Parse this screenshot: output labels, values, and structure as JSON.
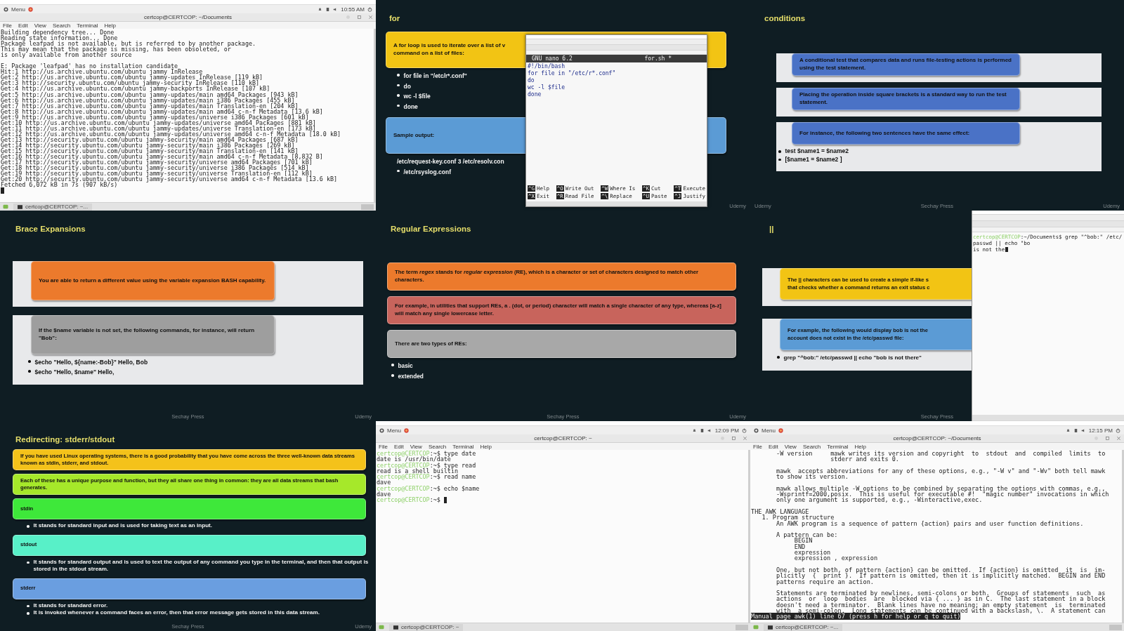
{
  "frames": [
    {
      "kind": "terminal",
      "menu": "Menu",
      "time": "10:55 AM",
      "title": "certcop@CERTCOP: ~/Documents",
      "menus": [
        "File",
        "Edit",
        "View",
        "Search",
        "Terminal",
        "Help"
      ],
      "taskbar": "certcop@CERTCOP: ~...",
      "paragraphs": [
        {
          "lines": [
            {
              "kind": "output",
              "text": "Building dependency tree... Done"
            },
            {
              "kind": "output",
              "text": "Reading state information... Done"
            },
            {
              "kind": "output",
              "text": "Package leafpad is not available, but is referred to by another package."
            },
            {
              "kind": "output",
              "text": "This may mean that the package is missing, has been obsoleted, or"
            },
            {
              "kind": "output",
              "text": "is only available from another source"
            }
          ]
        },
        {
          "lines": [
            {
              "kind": "output",
              "text": "E: Package 'leafpad' has no installation candidate"
            },
            {
              "kind": "output",
              "text": "Hit:1 http://us.archive.ubuntu.com/ubuntu jammy InRelease"
            },
            {
              "kind": "output",
              "text": "Get:2 http://us.archive.ubuntu.com/ubuntu jammy-updates InRelease [119 kB]"
            },
            {
              "kind": "output",
              "text": "Get:3 http://security.ubuntu.com/ubuntu jammy-security InRelease [110 kB]"
            },
            {
              "kind": "output",
              "text": "Get:4 http://us.archive.ubuntu.com/ubuntu jammy-backports InRelease [107 kB]"
            },
            {
              "kind": "output",
              "text": "Get:5 http://us.archive.ubuntu.com/ubuntu jammy-updates/main amd64 Packages [943 kB]"
            },
            {
              "kind": "output",
              "text": "Get:6 http://us.archive.ubuntu.com/ubuntu jammy-updates/main i386 Packages [455 kB]"
            },
            {
              "kind": "output",
              "text": "Get:7 http://us.archive.ubuntu.com/ubuntu jammy-updates/main Translation-en [204 kB]"
            },
            {
              "kind": "output",
              "text": "Get:8 http://us.archive.ubuntu.com/ubuntu jammy-updates/main amd64 c-n-f Metadata [13.6 kB]"
            },
            {
              "kind": "output",
              "text": "Get:9 http://us.archive.ubuntu.com/ubuntu jammy-updates/universe i386 Packages [601 kB]"
            },
            {
              "kind": "output",
              "text": "Get:10 http://us.archive.ubuntu.com/ubuntu jammy-updates/universe amd64 Packages [881 kB]"
            },
            {
              "kind": "output",
              "text": "Get:11 http://us.archive.ubuntu.com/ubuntu jammy-updates/universe Translation-en [173 kB]"
            },
            {
              "kind": "output",
              "text": "Get:12 http://us.archive.ubuntu.com/ubuntu jammy-updates/universe amd64 c-n-f Metadata [18.0 kB]"
            },
            {
              "kind": "output",
              "text": "Get:13 http://security.ubuntu.com/ubuntu jammy-security/main amd64 Packages [687 kB]"
            },
            {
              "kind": "output",
              "text": "Get:14 http://security.ubuntu.com/ubuntu jammy-security/main i386 Packages [269 kB]"
            },
            {
              "kind": "output",
              "text": "Get:15 http://security.ubuntu.com/ubuntu jammy-security/main Translation-en [141 kB]"
            },
            {
              "kind": "output",
              "text": "Get:16 http://security.ubuntu.com/ubuntu jammy-security/main amd64 c-n-f Metadata [8,832 B]"
            },
            {
              "kind": "output",
              "text": "Get:17 http://security.ubuntu.com/ubuntu jammy-security/universe amd64 Packages [701 kB]"
            },
            {
              "kind": "output",
              "text": "Get:18 http://security.ubuntu.com/ubuntu jammy-security/universe i386 Packages [514 kB]"
            },
            {
              "kind": "output",
              "text": "Get:19 http://security.ubuntu.com/ubuntu jammy-security/universe Translation-en [112 kB]"
            },
            {
              "kind": "output",
              "text": "Get:20 http://security.ubuntu.com/ubuntu jammy-security/universe amd64 c-n-f Metadata [13.6 kB]"
            },
            {
              "kind": "output",
              "text": "Fetched 6,072 kB in 7s (907 kB/s)"
            },
            {
              "kind": "cursor"
            }
          ]
        }
      ]
    },
    {
      "kind": "slide",
      "title": "for",
      "blocks": [
        {
          "kind": "box",
          "color": "#f2c414",
          "lines": [
            "A for loop is used to iterate over a list of v",
            "command on a list of files:"
          ],
          "bullets": [
            {
              "text": "for file in \"/etc/r*.conf\"",
              "bullet": true
            },
            {
              "text": "do",
              "bullet": true
            },
            {
              "text": "wc -l $file",
              "bullet": true
            },
            {
              "text": "done",
              "bullet": true
            }
          ]
        },
        {
          "kind": "box",
          "color": "#5b9bd5",
          "text": "Sample output:",
          "bullets": [
            {
              "text": "/etc/request-key.conf 3 /etc/resolv.con",
              "bullet": false
            },
            {
              "text": "/etc/rsyslog.conf",
              "bullet": true
            }
          ]
        }
      ],
      "overlay": {
        "kind": "nano",
        "header_left": "GNU nano 6.2",
        "header_right": "for.sh *",
        "code": [
          "#!/bin/bash",
          "for file in \"/etc/r*.conf\"",
          "do",
          "wc -l $file",
          "done"
        ],
        "shortcuts": [
          {
            "key": "^G",
            "label": "Help"
          },
          {
            "key": "^O",
            "label": "Write Out"
          },
          {
            "key": "^W",
            "label": "Where Is"
          },
          {
            "key": "^K",
            "label": "Cut"
          },
          {
            "key": "^T",
            "label": "Execute"
          },
          {
            "key": "^X",
            "label": "Exit"
          },
          {
            "key": "^R",
            "label": "Read File"
          },
          {
            "key": "^\\",
            "label": "Replace"
          },
          {
            "key": "^U",
            "label": "Paste"
          },
          {
            "key": "^J",
            "label": "Justify"
          }
        ]
      },
      "footer": [
        {
          "text": "Udemy",
          "kind": "right"
        }
      ]
    },
    {
      "kind": "slide",
      "title": "conditions",
      "blocks": [
        {
          "kind": "band",
          "color": "#4a72c6",
          "text": "A conditional test that compares data and runs file-testing actions is performed using the test statement."
        },
        {
          "kind": "band",
          "color": "#4a72c6",
          "text": "Placing the operation inside square brackets is a standard way to run the test statement."
        },
        {
          "kind": "band",
          "color": "#4a72c6",
          "text": "For instance, the following two sentences have the same effect:",
          "bullets": [
            {
              "text": "test $name1 = $name2",
              "bullet": true
            },
            {
              "text": "[$name1 = $name2 ]",
              "bullet": true
            }
          ]
        }
      ],
      "footer": [
        {
          "text": "Udemy",
          "kind": "left"
        },
        {
          "text": "Sechay Press",
          "kind": "center"
        },
        {
          "text": "Udemy",
          "kind": "right"
        }
      ]
    },
    {
      "kind": "slide",
      "title": "Brace Expansions",
      "blocks": [
        {
          "kind": "band",
          "color": "#ec7a2c",
          "text": "You are able to return a different value using the variable expansion BASH capability."
        },
        {
          "kind": "band",
          "color": "#9e9e9e",
          "text": "If the $name variable is not set, the following commands, for instance, will return \"Bob\":",
          "bullets": [
            {
              "text": "$echo \"Hello, ${name:-Bob}\" Hello, Bob",
              "bullet": true
            },
            {
              "text": "$echo \"Hello, $name\" Hello,",
              "bullet": true
            }
          ]
        }
      ],
      "footer": [
        {
          "text": "Sechay Press",
          "kind": "center"
        },
        {
          "text": "Udemy",
          "kind": "right"
        }
      ]
    },
    {
      "kind": "slide",
      "title": "Regular Expressions",
      "blocks": [
        {
          "kind": "box",
          "color": "#ec7a2c",
          "text": "The term *regex* stands for *regular expression* (RE), which is a character or set of characters designed to match other characters."
        },
        {
          "kind": "box",
          "color": "#c8645c",
          "text": "For example, in utilities that support REs, a . (dot, or period) character will match a single character of any type, whereas [a-z] will match any single lowercase letter."
        },
        {
          "kind": "box",
          "color": "#a8a8a8",
          "text": "There are two types of REs:",
          "bullets": [
            {
              "text": "basic",
              "bullet": true
            },
            {
              "text": "extended",
              "bullet": true
            }
          ]
        }
      ],
      "footer": [
        {
          "text": "Sechay Press",
          "kind": "center"
        },
        {
          "text": "Udemy",
          "kind": "right"
        }
      ]
    },
    {
      "kind": "slide",
      "title": "||",
      "blocks": [
        {
          "kind": "band",
          "color": "#f2c414",
          "lines": [
            "The || characters can be used to create a simple if-like s",
            "that checks whether a command returns an exit status c"
          ]
        },
        {
          "kind": "band",
          "color": "#5b9bd5",
          "lines": [
            "For example, the following would display bob is not the",
            "account does not exist in the /etc/passwd file:"
          ],
          "bullets": [
            {
              "text": "grep \"^bob:\" /etc/passwd || echo \"bob is not there\"",
              "bullet": true
            }
          ]
        }
      ],
      "overlay": {
        "kind": "mini_terminal",
        "lines": [
          {
            "kind": "prompt",
            "host": "certcop@CERTCOP",
            "text": ":~/Documents$ grep \"^bob:\" /etc/passwd || echo \"bo"
          },
          {
            "kind": "output",
            "text": "is not the",
            "cursor": true
          }
        ]
      },
      "footer": [
        {
          "text": "Sechay Press",
          "kind": "center"
        }
      ]
    },
    {
      "kind": "slide",
      "title": "Redirecting: stderr/stdout",
      "blocks": [
        {
          "kind": "box",
          "color": "#f4c21a",
          "text": "If you have used Linux operating systems, there is a good probability that you have come across the three well-known data streams known as stdin, stderr, and stdout."
        },
        {
          "kind": "box",
          "color": "#a6e82a",
          "text": "Each of these has a unique purpose and function, but they all share one thing in common: they are all data streams that bash generates."
        },
        {
          "kind": "box",
          "color": "#3ee83a",
          "text": "stdin",
          "bullets": [
            {
              "text": "It stands for standard input and is used for taking text as an input.",
              "bullet": true
            }
          ]
        },
        {
          "kind": "box",
          "color": "#58f0c8",
          "text": "stdout",
          "bullets": [
            {
              "text": "It stands for standard output and is used to text the output of any command you type in the terminal, and then that output is stored in the stdout stream.",
              "bullet": true
            }
          ]
        },
        {
          "kind": "box",
          "color": "#6a9ee0",
          "text": "stderr",
          "bullets": [
            {
              "text": "It stands for standard error.",
              "bullet": true
            },
            {
              "text": "It is invoked whenever a command faces an error, then that error message gets stored in this data stream.",
              "bullet": true
            }
          ]
        }
      ],
      "footer": [
        {
          "text": "Sechay Press",
          "kind": "center"
        },
        {
          "text": "Udemy",
          "kind": "right"
        }
      ]
    },
    {
      "kind": "terminal",
      "menu": "Menu",
      "time": "12:09 PM",
      "title": "certcop@CERTCOP: ~",
      "menus": [
        "File",
        "Edit",
        "View",
        "Search",
        "Terminal",
        "Help"
      ],
      "taskbar": "certcop@CERTCOP: ~",
      "paragraphs": [
        {
          "lines": [
            {
              "kind": "prompt",
              "host": "certcop@CERTCOP",
              "text": ":~$ type date"
            },
            {
              "kind": "output",
              "text": "date is /usr/bin/date"
            },
            {
              "kind": "prompt",
              "host": "certcop@CERTCOP",
              "text": ":~$ type read"
            },
            {
              "kind": "output",
              "text": "read is a shell builtin"
            },
            {
              "kind": "prompt",
              "host": "certcop@CERTCOP",
              "text": ":~$ read name"
            },
            {
              "kind": "output",
              "text": "dave"
            },
            {
              "kind": "prompt",
              "host": "certcop@CERTCOP",
              "text": ":~$ echo $name"
            },
            {
              "kind": "output",
              "text": "dave"
            },
            {
              "kind": "prompt",
              "host": "certcop@CERTCOP",
              "text": ":~$",
              "cursor": true
            }
          ]
        }
      ]
    },
    {
      "kind": "terminal",
      "menu": "Menu",
      "time": "12:15 PM",
      "title": "certcop@CERTCOP: ~/Documents",
      "menus": [
        "File",
        "Edit",
        "View",
        "Search",
        "Terminal",
        "Help"
      ],
      "taskbar": "certcop@CERTCOP: ~...",
      "status": "Manual page awk(1) line 67 (press h for help or q to quit)",
      "paragraphs": [
        {
          "lines": [
            {
              "kind": "output",
              "text": "       -W version     mawk writes its version and copyright  to  stdout  and  compiled  limits  to"
            },
            {
              "kind": "output",
              "text": "                      stderr and exits 0."
            }
          ]
        },
        {
          "lines": [
            {
              "kind": "output",
              "text": "       mawk  accepts abbreviations for any of these options, e.g., \"-W v\" and \"-Wv\" both tell mawk"
            },
            {
              "kind": "output",
              "text": "       to show its version."
            }
          ]
        },
        {
          "lines": [
            {
              "kind": "output",
              "text": "       mawk allows multiple -W options to be combined by separating the options with commas, e.g.,"
            },
            {
              "kind": "output",
              "text": "       -Wsprintf=2000,posix.  This is useful for executable #!  \"magic number\" invocations in which"
            },
            {
              "kind": "output",
              "text": "       only one argument is supported, e.g., -Winteractive,exec."
            }
          ]
        },
        {
          "lines": [
            {
              "kind": "output",
              "text": "THE AWK LANGUAGE"
            },
            {
              "kind": "output",
              "text": "   1. Program structure"
            },
            {
              "kind": "output",
              "text": "       An AWK program is a sequence of pattern {action} pairs and user function definitions."
            }
          ]
        },
        {
          "lines": [
            {
              "kind": "output",
              "text": "       A pattern can be:"
            },
            {
              "kind": "output",
              "text": "            BEGIN"
            },
            {
              "kind": "output",
              "text": "            END"
            },
            {
              "kind": "output",
              "text": "            expression"
            },
            {
              "kind": "output",
              "text": "            expression , expression"
            }
          ]
        },
        {
          "lines": [
            {
              "kind": "output",
              "text": "       One, but not both, of pattern {action} can be omitted.  If {action} is omitted  it  is  im-"
            },
            {
              "kind": "output",
              "text": "       plicitly  {  print }.  If pattern is omitted, then it is implicitly matched.  BEGIN and END"
            },
            {
              "kind": "output",
              "text": "       patterns require an action."
            }
          ]
        },
        {
          "lines": [
            {
              "kind": "output",
              "text": "       Statements are terminated by newlines, semi-colons or both.  Groups of statements  such  as"
            },
            {
              "kind": "output",
              "text": "       actions  or  loop  bodies  are  blocked via { ... } as in C.  The last statement in a block"
            },
            {
              "kind": "output",
              "text": "       doesn't need a terminator.  Blank lines have no meaning; an empty statement  is  terminated"
            },
            {
              "kind": "output",
              "text": "       with  a semi-colon.  Long statements can be continued with a backslash, \\.  A statement can"
            }
          ]
        }
      ]
    }
  ]
}
